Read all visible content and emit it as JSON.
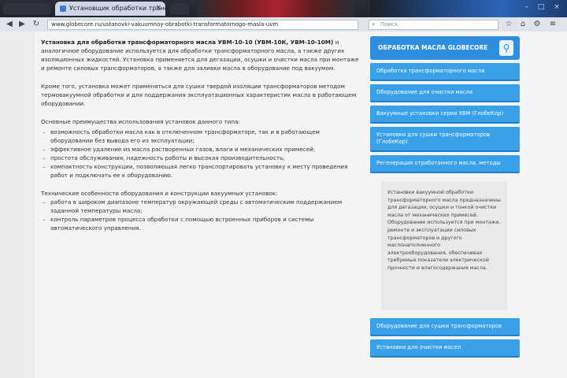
{
  "browser": {
    "active_tab": {
      "title": "Установщик обработки трансформаторного масла УВМ",
      "close": "×"
    },
    "window_buttons": [
      "–",
      "□",
      "×"
    ],
    "nav_icons": [
      "back-icon",
      "forward-icon",
      "reload-icon"
    ],
    "address": "www.globecore.ru/ustanovki-vakuumnoy-obrabotki-transformatornogo-masla-uvm",
    "search_placeholder": "Поиск"
  },
  "article": {
    "lead_bold": "Установка для обработки трансформаторного масла УВМ-10-10 (УВМ-10К, УВМ-10-10М) ",
    "lead_rest": "и аналогичное оборудование используется для обработки трансформаторного масла, а также других изоляционных жидкостей. Установка применяется для дегазации, осушки и очистки масла при монтаже и ремонте силовых трансформаторов, а также для заливки масла в оборудование под вакуумом.",
    "para2": "Кроме того, установка может применяться для сушки твердой изоляции трансформаторов методом термовакуумной обработки и для поддержания эксплуатационных характеристик масла в работающем оборудовании.",
    "para3_intro": "Основные преимущества использования установок данного типа:",
    "list1": [
      "возможность обработки масла как в отключенном трансформаторе, так и в работающем оборудовании без вывода его из эксплуатации;",
      "эффективное удаление из масла растворенных газов, влаги и механических примесей;",
      "простота обслуживания, надежность работы и высокая производительность;",
      "компактность конструкции, позволяющая легко транспортировать установку к месту проведения работ и подключать ее к оборудованию."
    ],
    "para4_intro": "Технические особенности оборудования и конструкции вакуумных установок:",
    "list2": [
      "работа в широком диапазоне температур окружающей среды с автоматическим поддержанием заданной температуры масла;",
      "контроль параметров процесса обработки с помощью встроенных приборов и системы автоматического управления."
    ]
  },
  "sidebar": {
    "title": "ОБРАБОТКА МАСЛА GLOBECORE",
    "pin_icon": "pin-icon",
    "links": [
      "Обработка трансформаторного масла",
      "Оборудование для очистки масла",
      "Вакуумные установки серии УВМ (ГлобеКор)",
      "Установки для сушки трансформаторов (ГлобеКор)",
      "Регенерация отработанного масла, методы"
    ],
    "note": "Установки вакуумной обработки трансформаторного масла предназначены для дегазации, осушки и тонкой очистки масла от механических примесей. Оборудование используется при монтаже, ремонте и эксплуатации силовых трансформаторов и другого маслонаполненного электрооборудования, обеспечивая требуемые показатели электрической прочности и влагосодержания масла.",
    "links2": [
      "Оборудование для сушки трансформаторов",
      "Установки для очистки масел"
    ]
  },
  "colors": {
    "accent": "#2d8ee0",
    "link_bg": "#39a0ea"
  }
}
